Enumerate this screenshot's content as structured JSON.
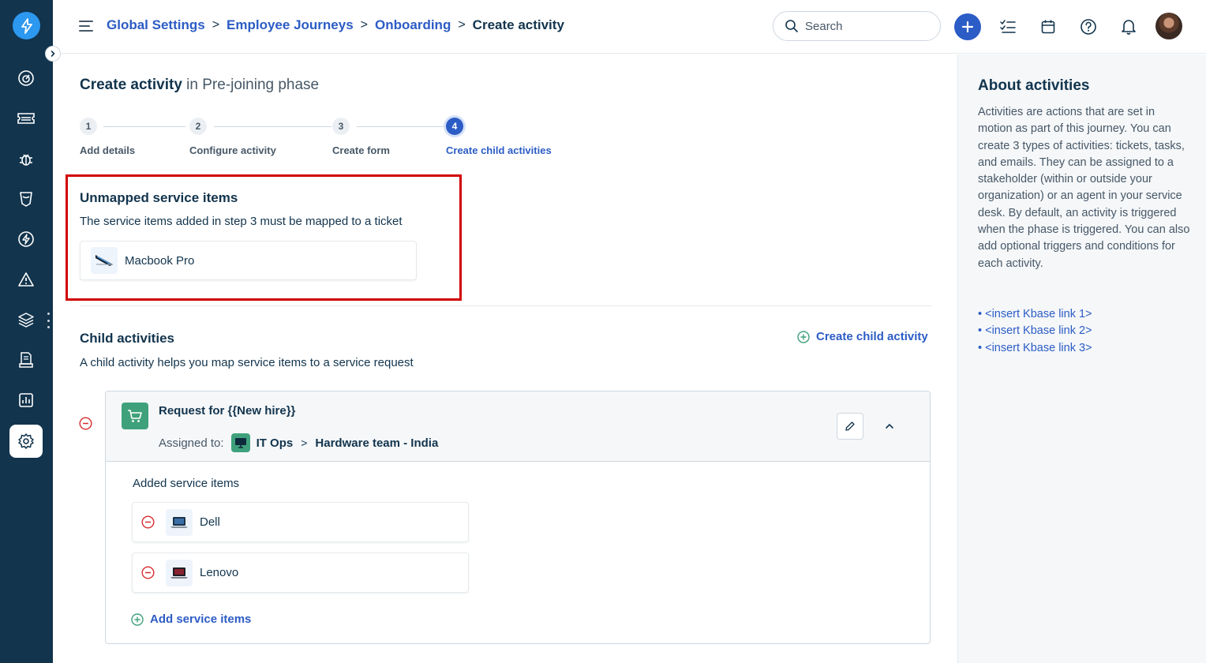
{
  "breadcrumb": {
    "items": [
      "Global Settings",
      "Employee Journeys",
      "Onboarding"
    ],
    "separator": ">",
    "current": "Create activity"
  },
  "search": {
    "placeholder": "Search"
  },
  "page": {
    "title_bold": "Create activity",
    "title_rest": " in Pre-joining phase"
  },
  "steps": [
    {
      "number": "1",
      "label": "Add details"
    },
    {
      "number": "2",
      "label": "Configure activity"
    },
    {
      "number": "3",
      "label": "Create form"
    },
    {
      "number": "4",
      "label": "Create child activities"
    }
  ],
  "active_step": 4,
  "unmapped": {
    "title": "Unmapped service items",
    "description": "The service items added in step 3 must be mapped to a ticket",
    "item": "Macbook Pro"
  },
  "child": {
    "title": "Child activities",
    "description": "A child activity helps you map service items to a service request",
    "create_label": "Create child activity"
  },
  "activity": {
    "title": "Request for {{New hire}}",
    "assigned_label": "Assigned to:",
    "group": "IT Ops",
    "arrow": ">",
    "team": "Hardware team - India",
    "added_label": "Added service items",
    "items": [
      "Dell",
      "Lenovo"
    ],
    "add_label": "Add service items"
  },
  "aside": {
    "title": "About activities",
    "body": "Activities are actions that are set in motion as part of this journey. You can create 3 types of activities: tickets, tasks, and emails. They can be assigned to a stakeholder (within or outside your organization) or an agent in your service desk. By default, an activity is triggered when the phase is triggered. You can also add optional triggers and conditions for each activity.",
    "links": [
      "• <insert Kbase link 1>",
      "• <insert Kbase link 2>",
      "• <insert Kbase link 3>"
    ]
  },
  "icons": {
    "rail": [
      "dashboard-icon",
      "tickets-icon",
      "problems-icon",
      "changes-icon",
      "releases-icon",
      "alerts-icon",
      "assets-icon",
      "solutions-icon",
      "reports-icon",
      "admin-settings-icon"
    ],
    "header": [
      "search-icon",
      "plus-icon",
      "tasks-icon",
      "calendar-icon",
      "help-icon",
      "bell-icon"
    ]
  },
  "colors": {
    "rail": "#12344d",
    "link": "#2c5cc5",
    "highlight": "#d10000",
    "green": "#3fa17c",
    "remove": "#d72d30"
  }
}
